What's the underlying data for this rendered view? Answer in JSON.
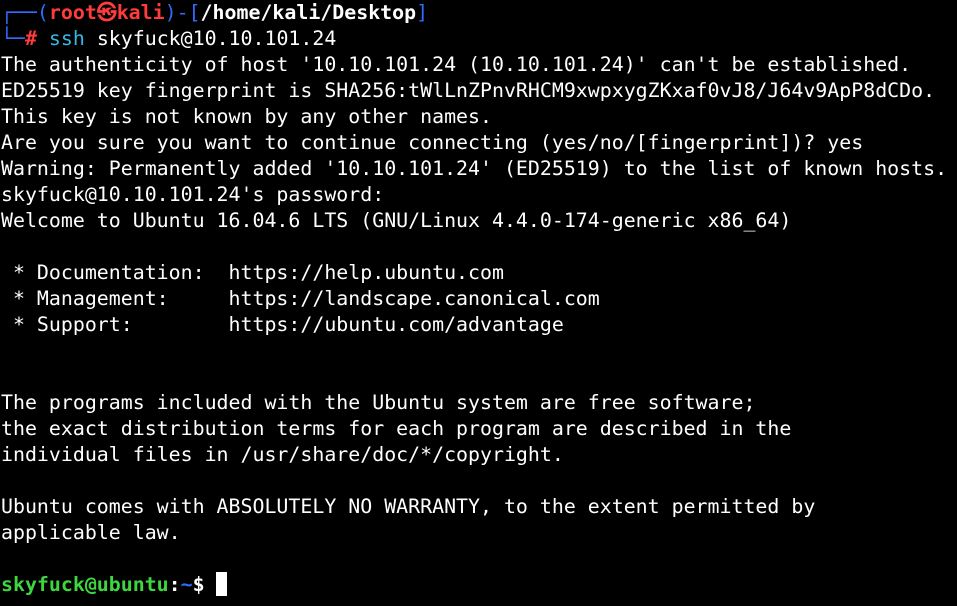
{
  "prompt": {
    "bracket_open": "┌──(",
    "user": "root",
    "at": "㉿",
    "host": "kali",
    "sep": ")-[",
    "cwd": "/home/kali/Desktop",
    "bracket_close": "]",
    "corner": "└─",
    "symbol": "#",
    "command_name": "ssh",
    "command_args": " skyfuck@10.10.101.24"
  },
  "output": [
    "The authenticity of host '10.10.101.24 (10.10.101.24)' can't be established.",
    "ED25519 key fingerprint is SHA256:tWlLnZPnvRHCM9xwpxygZKxaf0vJ8/J64v9ApP8dCDo.",
    "This key is not known by any other names.",
    "Are you sure you want to continue connecting (yes/no/[fingerprint])? yes",
    "Warning: Permanently added '10.10.101.24' (ED25519) to the list of known hosts.",
    "skyfuck@10.10.101.24's password:",
    "Welcome to Ubuntu 16.04.6 LTS (GNU/Linux 4.4.0-174-generic x86_64)",
    "",
    " * Documentation:  https://help.ubuntu.com",
    " * Management:     https://landscape.canonical.com",
    " * Support:        https://ubuntu.com/advantage",
    "",
    "",
    "The programs included with the Ubuntu system are free software;",
    "the exact distribution terms for each program are described in the",
    "individual files in /usr/share/doc/*/copyright.",
    "",
    "Ubuntu comes with ABSOLUTELY NO WARRANTY, to the extent permitted by",
    "applicable law.",
    ""
  ],
  "remote_prompt": {
    "user_host": "skyfuck@ubuntu",
    "colon": ":",
    "cwd": "~",
    "symbol": "$"
  },
  "colors": {
    "background": "#000000",
    "prompt_frame": "#2f6bff",
    "root_user": "#ff3b3b",
    "command": "#34b8e8",
    "remote_user": "#3ed63e",
    "text": "#ffffff"
  }
}
